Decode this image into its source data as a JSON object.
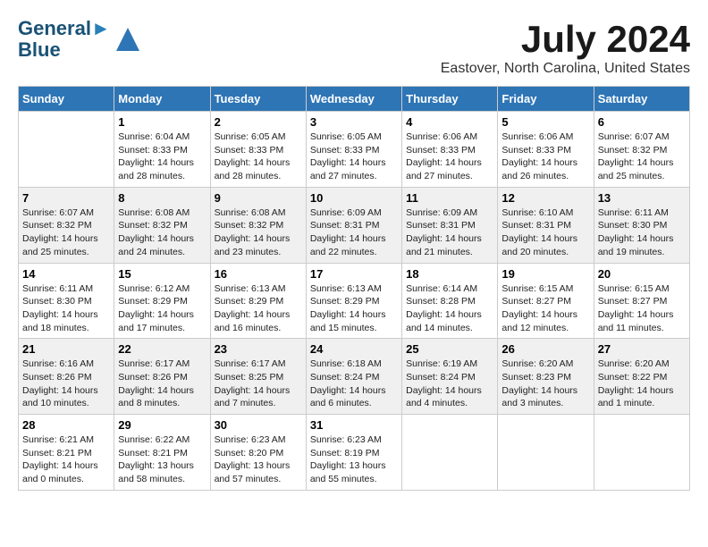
{
  "logo": {
    "line1": "General",
    "line2": "Blue"
  },
  "title": "July 2024",
  "location": "Eastover, North Carolina, United States",
  "days_of_week": [
    "Sunday",
    "Monday",
    "Tuesday",
    "Wednesday",
    "Thursday",
    "Friday",
    "Saturday"
  ],
  "weeks": [
    [
      {
        "day": "",
        "info": ""
      },
      {
        "day": "1",
        "info": "Sunrise: 6:04 AM\nSunset: 8:33 PM\nDaylight: 14 hours\nand 28 minutes."
      },
      {
        "day": "2",
        "info": "Sunrise: 6:05 AM\nSunset: 8:33 PM\nDaylight: 14 hours\nand 28 minutes."
      },
      {
        "day": "3",
        "info": "Sunrise: 6:05 AM\nSunset: 8:33 PM\nDaylight: 14 hours\nand 27 minutes."
      },
      {
        "day": "4",
        "info": "Sunrise: 6:06 AM\nSunset: 8:33 PM\nDaylight: 14 hours\nand 27 minutes."
      },
      {
        "day": "5",
        "info": "Sunrise: 6:06 AM\nSunset: 8:33 PM\nDaylight: 14 hours\nand 26 minutes."
      },
      {
        "day": "6",
        "info": "Sunrise: 6:07 AM\nSunset: 8:32 PM\nDaylight: 14 hours\nand 25 minutes."
      }
    ],
    [
      {
        "day": "7",
        "info": ""
      },
      {
        "day": "8",
        "info": "Sunrise: 6:08 AM\nSunset: 8:32 PM\nDaylight: 14 hours\nand 24 minutes."
      },
      {
        "day": "9",
        "info": "Sunrise: 6:08 AM\nSunset: 8:32 PM\nDaylight: 14 hours\nand 23 minutes."
      },
      {
        "day": "10",
        "info": "Sunrise: 6:09 AM\nSunset: 8:31 PM\nDaylight: 14 hours\nand 22 minutes."
      },
      {
        "day": "11",
        "info": "Sunrise: 6:09 AM\nSunset: 8:31 PM\nDaylight: 14 hours\nand 21 minutes."
      },
      {
        "day": "12",
        "info": "Sunrise: 6:10 AM\nSunset: 8:31 PM\nDaylight: 14 hours\nand 20 minutes."
      },
      {
        "day": "13",
        "info": "Sunrise: 6:11 AM\nSunset: 8:30 PM\nDaylight: 14 hours\nand 19 minutes."
      }
    ],
    [
      {
        "day": "14",
        "info": ""
      },
      {
        "day": "15",
        "info": "Sunrise: 6:12 AM\nSunset: 8:29 PM\nDaylight: 14 hours\nand 17 minutes."
      },
      {
        "day": "16",
        "info": "Sunrise: 6:13 AM\nSunset: 8:29 PM\nDaylight: 14 hours\nand 16 minutes."
      },
      {
        "day": "17",
        "info": "Sunrise: 6:13 AM\nSunset: 8:29 PM\nDaylight: 14 hours\nand 15 minutes."
      },
      {
        "day": "18",
        "info": "Sunrise: 6:14 AM\nSunset: 8:28 PM\nDaylight: 14 hours\nand 14 minutes."
      },
      {
        "day": "19",
        "info": "Sunrise: 6:15 AM\nSunset: 8:27 PM\nDaylight: 14 hours\nand 12 minutes."
      },
      {
        "day": "20",
        "info": "Sunrise: 6:15 AM\nSunset: 8:27 PM\nDaylight: 14 hours\nand 11 minutes."
      }
    ],
    [
      {
        "day": "21",
        "info": ""
      },
      {
        "day": "22",
        "info": "Sunrise: 6:17 AM\nSunset: 8:26 PM\nDaylight: 14 hours\nand 8 minutes."
      },
      {
        "day": "23",
        "info": "Sunrise: 6:17 AM\nSunset: 8:25 PM\nDaylight: 14 hours\nand 7 minutes."
      },
      {
        "day": "24",
        "info": "Sunrise: 6:18 AM\nSunset: 8:24 PM\nDaylight: 14 hours\nand 6 minutes."
      },
      {
        "day": "25",
        "info": "Sunrise: 6:19 AM\nSunset: 8:24 PM\nDaylight: 14 hours\nand 4 minutes."
      },
      {
        "day": "26",
        "info": "Sunrise: 6:20 AM\nSunset: 8:23 PM\nDaylight: 14 hours\nand 3 minutes."
      },
      {
        "day": "27",
        "info": "Sunrise: 6:20 AM\nSunset: 8:22 PM\nDaylight: 14 hours\nand 1 minute."
      }
    ],
    [
      {
        "day": "28",
        "info": "Sunrise: 6:21 AM\nSunset: 8:21 PM\nDaylight: 14 hours\nand 0 minutes."
      },
      {
        "day": "29",
        "info": "Sunrise: 6:22 AM\nSunset: 8:21 PM\nDaylight: 13 hours\nand 58 minutes."
      },
      {
        "day": "30",
        "info": "Sunrise: 6:23 AM\nSunset: 8:20 PM\nDaylight: 13 hours\nand 57 minutes."
      },
      {
        "day": "31",
        "info": "Sunrise: 6:23 AM\nSunset: 8:19 PM\nDaylight: 13 hours\nand 55 minutes."
      },
      {
        "day": "",
        "info": ""
      },
      {
        "day": "",
        "info": ""
      },
      {
        "day": "",
        "info": ""
      }
    ]
  ],
  "week1_sunday_info": "Sunrise: 6:07 AM\nSunset: 8:32 PM\nDaylight: 14 hours\nand 25 minutes.",
  "week2_sunday_info": "Sunrise: 6:07 AM\nSunset: 8:32 PM\nDaylight: 14 hours\nand 25 minutes.",
  "week3_sunday_info": "Sunrise: 6:11 AM\nSunset: 8:30 PM\nDaylight: 14 hours\nand 18 minutes.",
  "week4_sunday_info": "Sunrise: 6:16 AM\nSunset: 8:26 PM\nDaylight: 14 hours\nand 10 minutes."
}
